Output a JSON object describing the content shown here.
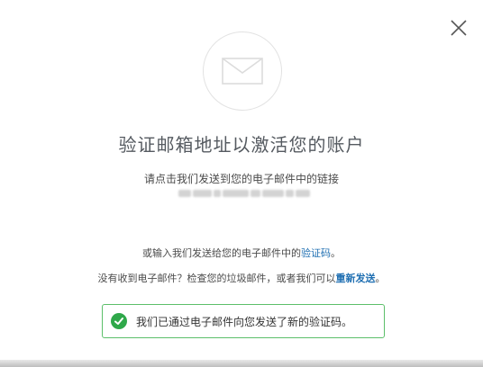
{
  "dialog": {
    "title": "验证邮箱地址以激活您的账户",
    "subtitle": "请点击我们发送到您的电子邮件中的链接",
    "code_line": {
      "prefix": "或输入我们发送给您的电子邮件中的",
      "link": "验证码",
      "suffix": "。"
    },
    "resend_line": {
      "prefix": "没有收到电子邮件？检查您的垃圾邮件，或者我们可以",
      "link": "重新发送",
      "suffix": "。"
    },
    "success_message": "我们已通过电子邮件向您发送了新的验证码。"
  },
  "icons": {
    "close": "close-icon",
    "envelope": "envelope-icon",
    "success": "check-circle-icon"
  },
  "colors": {
    "link": "#1f6fb2",
    "success_border": "#5cbf6a",
    "success_icon": "#2fa84a",
    "title": "#555a60"
  }
}
